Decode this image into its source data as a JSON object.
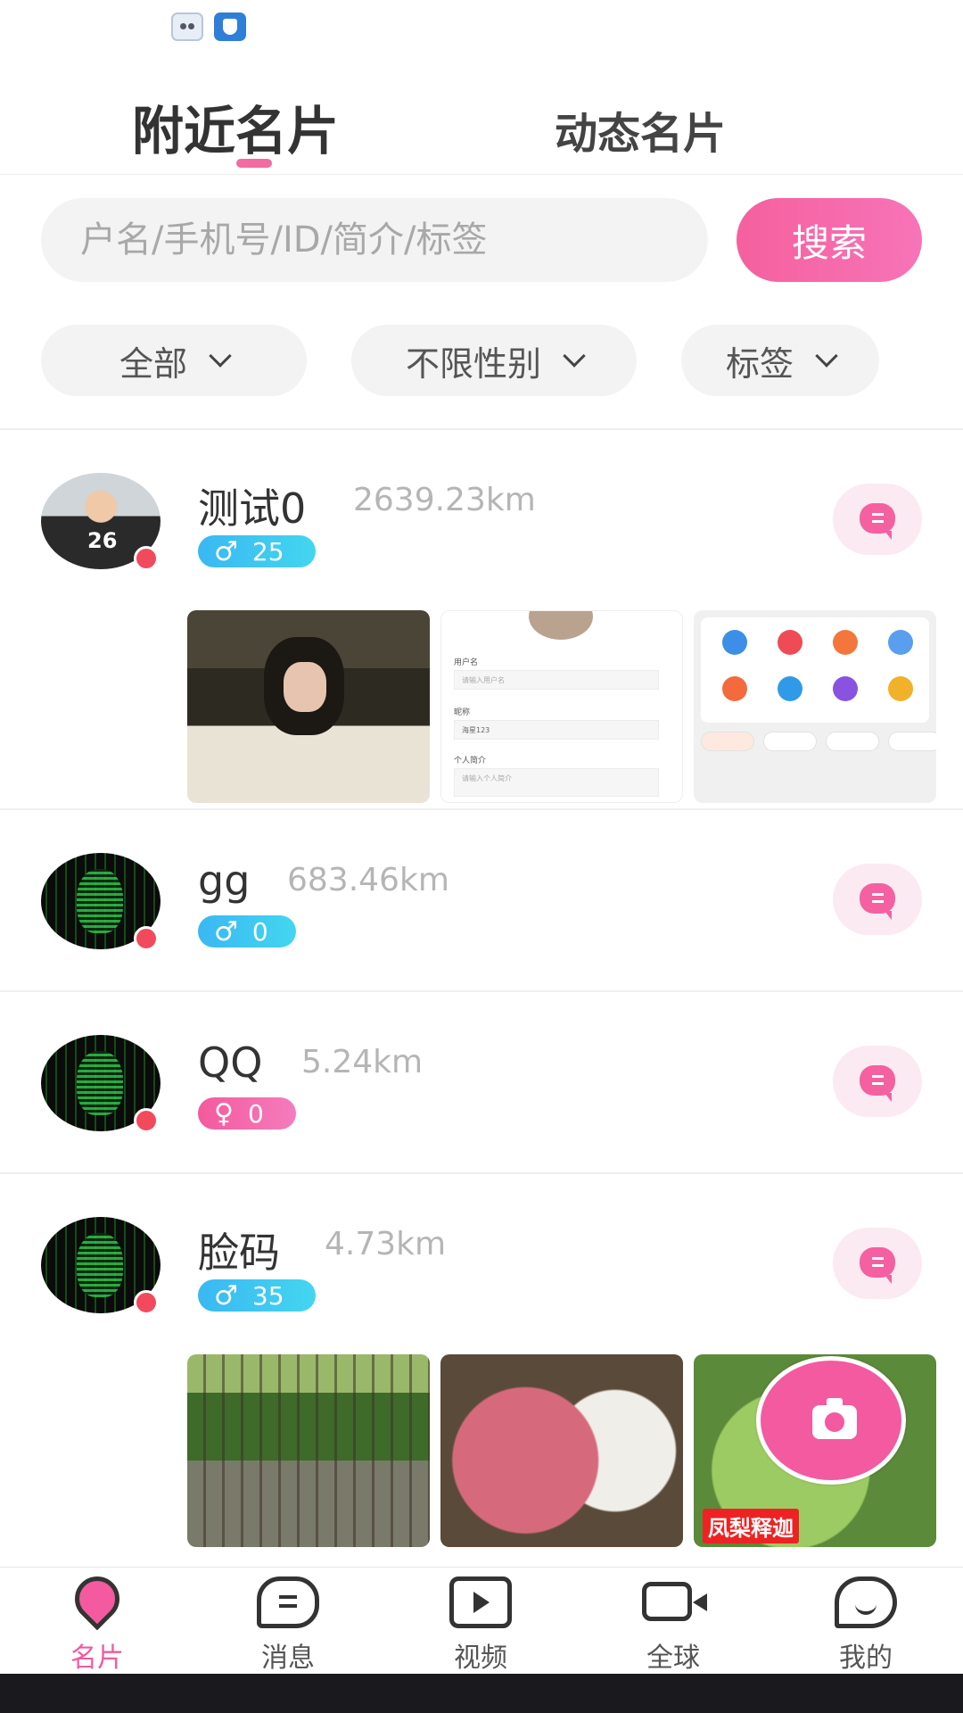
{
  "header": {
    "tabs": [
      {
        "label": "附近名片",
        "active": true
      },
      {
        "label": "动态名片",
        "active": false
      }
    ]
  },
  "search": {
    "placeholder": "户名/手机号/ID/简介/标签",
    "button_label": "搜索"
  },
  "filters": [
    {
      "label": "全部"
    },
    {
      "label": "不限性别"
    },
    {
      "label": "标签"
    }
  ],
  "users": [
    {
      "name": "测试0",
      "distance": "2639.23km",
      "gender": "male",
      "gender_symbol": "♂",
      "age": "25",
      "online": true,
      "has_photos": true
    },
    {
      "name": "gg",
      "distance": "683.46km",
      "gender": "male",
      "gender_symbol": "♂",
      "age": "0",
      "online": true,
      "has_photos": false
    },
    {
      "name": "QQ",
      "distance": "5.24km",
      "gender": "female",
      "gender_symbol": "♀",
      "age": "0",
      "online": true,
      "has_photos": false
    },
    {
      "name": "脸码",
      "distance": "4.73km",
      "gender": "male",
      "gender_symbol": "♂",
      "age": "35",
      "online": true,
      "has_photos": true
    }
  ],
  "thumb_form": {
    "label_username": "用户名",
    "placeholder_username": "请输入用户名",
    "label_nickname": "昵称",
    "value_nickname": "海星123",
    "label_bio": "个人简介",
    "placeholder_bio": "请输入个人简介"
  },
  "thumb_sugar_label": "凤梨释迦",
  "bottom_nav": [
    {
      "label": "名片",
      "icon": "location-pin-icon",
      "active": true
    },
    {
      "label": "消息",
      "icon": "chat-icon",
      "active": false
    },
    {
      "label": "视频",
      "icon": "video-icon",
      "active": false
    },
    {
      "label": "全球",
      "icon": "video-camera-icon",
      "active": false
    },
    {
      "label": "我的",
      "icon": "profile-icon",
      "active": false
    }
  ],
  "colors": {
    "accent": "#f35aa0",
    "male_badge": "#3ab8f2",
    "female_badge": "#f45a9e",
    "online_dot": "#f24a5c"
  }
}
